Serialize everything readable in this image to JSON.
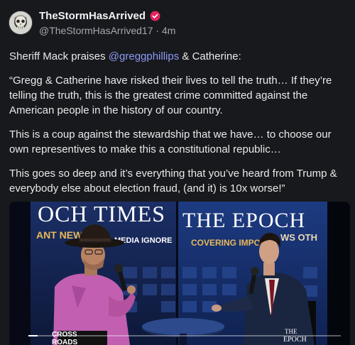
{
  "post": {
    "display_name": "TheStormHasArrived",
    "handle": "@TheStormHasArrived17",
    "separator": "·",
    "timestamp": "4m",
    "paragraphs": [
      {
        "prefix": "Sheriff Mack praises ",
        "mention": "@greggphillips",
        "suffix": " & Catherine:"
      },
      {
        "text": "“Gregg & Catherine have risked their lives to tell the truth… If they’re telling the truth, this is the greatest crime committed against the American people in the history of our country."
      },
      {
        "text": "This is a coup against the stewardship that we have… to choose our own representives to make this a constitutional republic…"
      },
      {
        "text": "This goes so deep and it’s everything that you’ve heard from Trump & everybody else about election fraud, (and it) is 10x worse!”"
      }
    ]
  },
  "video": {
    "backdrop_left_line1": "OCH TIMES",
    "backdrop_left_line2": "ANT NEW",
    "backdrop_left_line2b": "MEDIA IGNORE",
    "backdrop_right_line1": "THE EPOCH",
    "backdrop_right_line2": "COVERING IMPORT",
    "backdrop_right_line2b": "WS OTH",
    "logo_bottom_left_1": "CROSS",
    "logo_bottom_left_2": "ROADS",
    "logo_bottom_right_1": "THE",
    "logo_bottom_right_2": "EPOCH",
    "progress_fraction": 0.03
  },
  "colors": {
    "background": "#17191c",
    "mention": "#8d9af7",
    "verified": "#e0245e",
    "backdrop_blue": "#16306e"
  },
  "icons": {
    "verified": "verified-badge-icon",
    "avatar": "skull-avatar"
  }
}
